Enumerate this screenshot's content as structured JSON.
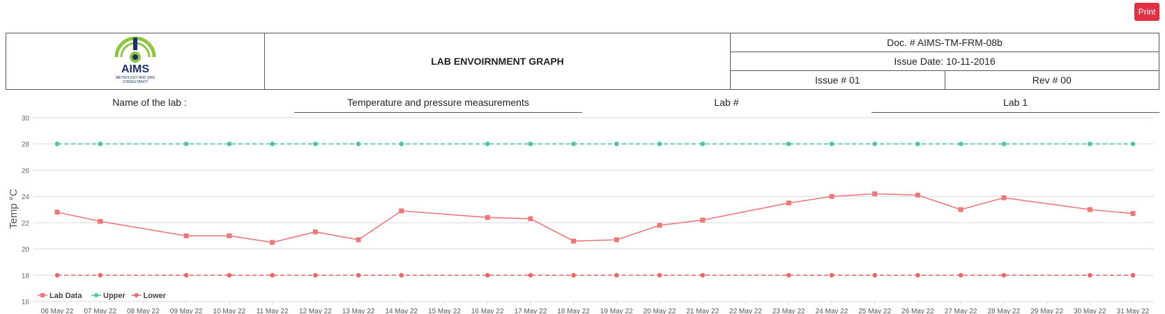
{
  "print_label": "Print",
  "header": {
    "logo_text": "AIMS",
    "logo_sub1": "METROLOGY AND QMS",
    "logo_sub2": "CONSULTANCY",
    "title": "LAB ENVOIRNMENT GRAPH",
    "doc_no": "Doc. # AIMS-TM-FRM-08b",
    "issue_date": "Issue Date: 10-11-2016",
    "issue_no": "Issue # 01",
    "rev_no": "Rev # 00"
  },
  "lab_info": {
    "name_label": "Name of the lab :",
    "name_value": "Temperature and pressure measurements",
    "lab_no_label": "Lab #",
    "lab_no_value": "Lab 1"
  },
  "colors": {
    "lab": "#ee7777",
    "upper": "#4cc79a",
    "lower": "#e86868",
    "grid": "#d9d9d9",
    "print": "#e03143"
  },
  "chart_data": {
    "type": "line",
    "ylabel": "Temp  °C",
    "ylim": [
      16,
      30
    ],
    "yticks": [
      16,
      18,
      20,
      22,
      24,
      26,
      28,
      30
    ],
    "categories": [
      "06 May 22",
      "07 May 22",
      "08 May 22",
      "09 May 22",
      "10 May 22",
      "11 May 22",
      "12 May 22",
      "13 May 22",
      "14 May 22",
      "15 May 22",
      "16 May 22",
      "17 May 22",
      "18 May 22",
      "19 May 22",
      "20 May 22",
      "21 May 22",
      "22 May 22",
      "23 May 22",
      "24 May 22",
      "25 May 22",
      "26 May 22",
      "27 May 22",
      "28 May 22",
      "29 May 22",
      "30 May 22",
      "31 May 22"
    ],
    "legend_position": "bottom-left",
    "series": [
      {
        "name": "Lab Data",
        "marker": "square",
        "dashed": false,
        "values": [
          22.8,
          22.1,
          null,
          21.0,
          21.0,
          20.5,
          21.3,
          20.7,
          22.9,
          null,
          22.4,
          22.3,
          20.6,
          20.7,
          21.8,
          22.2,
          null,
          23.5,
          24.0,
          24.2,
          24.1,
          23.0,
          23.9,
          null,
          23.0,
          22.7
        ]
      },
      {
        "name": "Upper",
        "marker": "circle",
        "dashed": true,
        "values": [
          28,
          28,
          null,
          28,
          28,
          28,
          28,
          28,
          28,
          null,
          28,
          28,
          28,
          28,
          28,
          28,
          null,
          28,
          28,
          28,
          28,
          28,
          28,
          null,
          28,
          28
        ]
      },
      {
        "name": "Lower",
        "marker": "circle",
        "dashed": true,
        "values": [
          18,
          18,
          null,
          18,
          18,
          18,
          18,
          18,
          18,
          null,
          18,
          18,
          18,
          18,
          18,
          18,
          null,
          18,
          18,
          18,
          18,
          18,
          18,
          null,
          18,
          18
        ]
      }
    ]
  }
}
